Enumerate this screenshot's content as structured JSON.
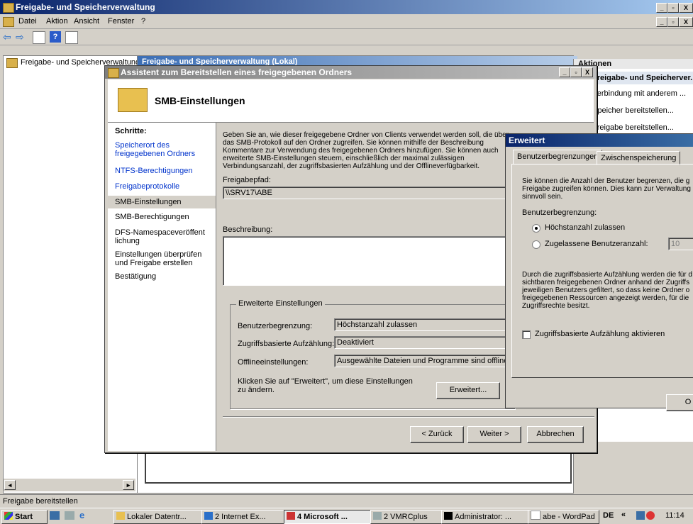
{
  "main_window": {
    "title": "Freigabe- und Speicherverwaltung"
  },
  "menu": [
    "Datei",
    "Aktion",
    "Ansicht",
    "Fenster",
    "?"
  ],
  "tree": {
    "root_label": "Freigabe- und Speicherverwaltung"
  },
  "center_header": "Freigabe- und Speicherverwaltung (Lokal)",
  "actions_pane": {
    "title": "Aktionen",
    "section": "Freigabe- und Speicherver...",
    "items": [
      "Verbindung mit anderem ...",
      "Speicher bereitstellen...",
      "Freigabe bereitstellen..."
    ]
  },
  "wizard": {
    "title": "Assistent zum Bereitstellen eines freigegebenen Ordners",
    "heading": "SMB-Einstellungen",
    "steps_label": "Schritte:",
    "steps": [
      "Speicherort des freigegebenen Ordners",
      "NTFS-Berechtigungen",
      "Freigabeprotokolle",
      "SMB-Einstellungen",
      "SMB-Berechtigungen",
      "DFS-Namespaceveröffentlichung",
      "Einstellungen überprüfen und Freigabe erstellen",
      "Bestätigung"
    ],
    "intro": "Geben Sie an, wie dieser freigegebene Ordner von Clients verwendet werden soll, die über das SMB-Protokoll auf den Ordner zugreifen. Sie können mithilfe der Beschreibung Kommentare zur Verwendung des freigegebenen Ordners hinzufügen. Sie können auch erweiterte SMB-Einstellungen steuern, einschließlich der maximal zulässigen Verbindungsanzahl, der zugriffsbasierten Aufzählung und der Offlineverfügbarkeit.",
    "share_path_label": "Freigabepfad:",
    "share_path_value": "\\\\SRV17\\ABE",
    "description_label": "Beschreibung:",
    "description_value": "",
    "advanced_group_label": "Erweiterte Einstellungen",
    "user_limit_label": "Benutzerbegrenzung:",
    "user_limit_value": "Höchstanzahl zulassen",
    "abe_label": "Zugriffsbasierte Aufzählung:",
    "abe_value": "Deaktiviert",
    "offline_label": "Offlineeinstellungen:",
    "offline_value": "Ausgewählte Dateien und Programme sind offline ver",
    "advanced_hint": "Klicken Sie auf \"Erweitert\", um diese Einstellungen zu ändern.",
    "advanced_button": "Erweitert...",
    "back_button": "< Zurück",
    "next_button": "Weiter >",
    "cancel_button": "Abbrechen"
  },
  "advanced_dialog": {
    "title": "Erweitert",
    "tabs": [
      "Benutzerbegrenzungen",
      "Zwischenspeicherung"
    ],
    "desc1": "Sie können die Anzahl der Benutzer begrenzen, die g Freigabe zugreifen können. Dies kann zur Verwaltung sinnvoll sein.",
    "user_limit_label": "Benutzerbegrenzung:",
    "radio_max": "Höchstanzahl zulassen",
    "radio_allowed": "Zugelassene Benutzeranzahl:",
    "allowed_count": "10",
    "desc2": "Durch die zugriffsbasierte Aufzählung werden die für d sichtbaren freigegebenen Ordner anhand der Zugriffs jeweiligen Benutzers gefiltert, so dass keine Ordner o freigegebenen Ressourcen angezeigt werden, für die Zugriffsrechte besitzt.",
    "abe_checkbox": "Zugriffsbasierte Aufzählung aktivieren",
    "abe_checked": false,
    "ok_button": "O"
  },
  "status_bar": "Freigabe bereitstellen",
  "taskbar": {
    "start": "Start",
    "tasks": [
      "Lokaler Datentr...",
      "2 Internet Ex...",
      "4 Microsoft ...",
      "2 VMRCplus",
      "Administrator: ...",
      "abe - WordPad"
    ],
    "language": "DE",
    "clock": "11:14"
  }
}
